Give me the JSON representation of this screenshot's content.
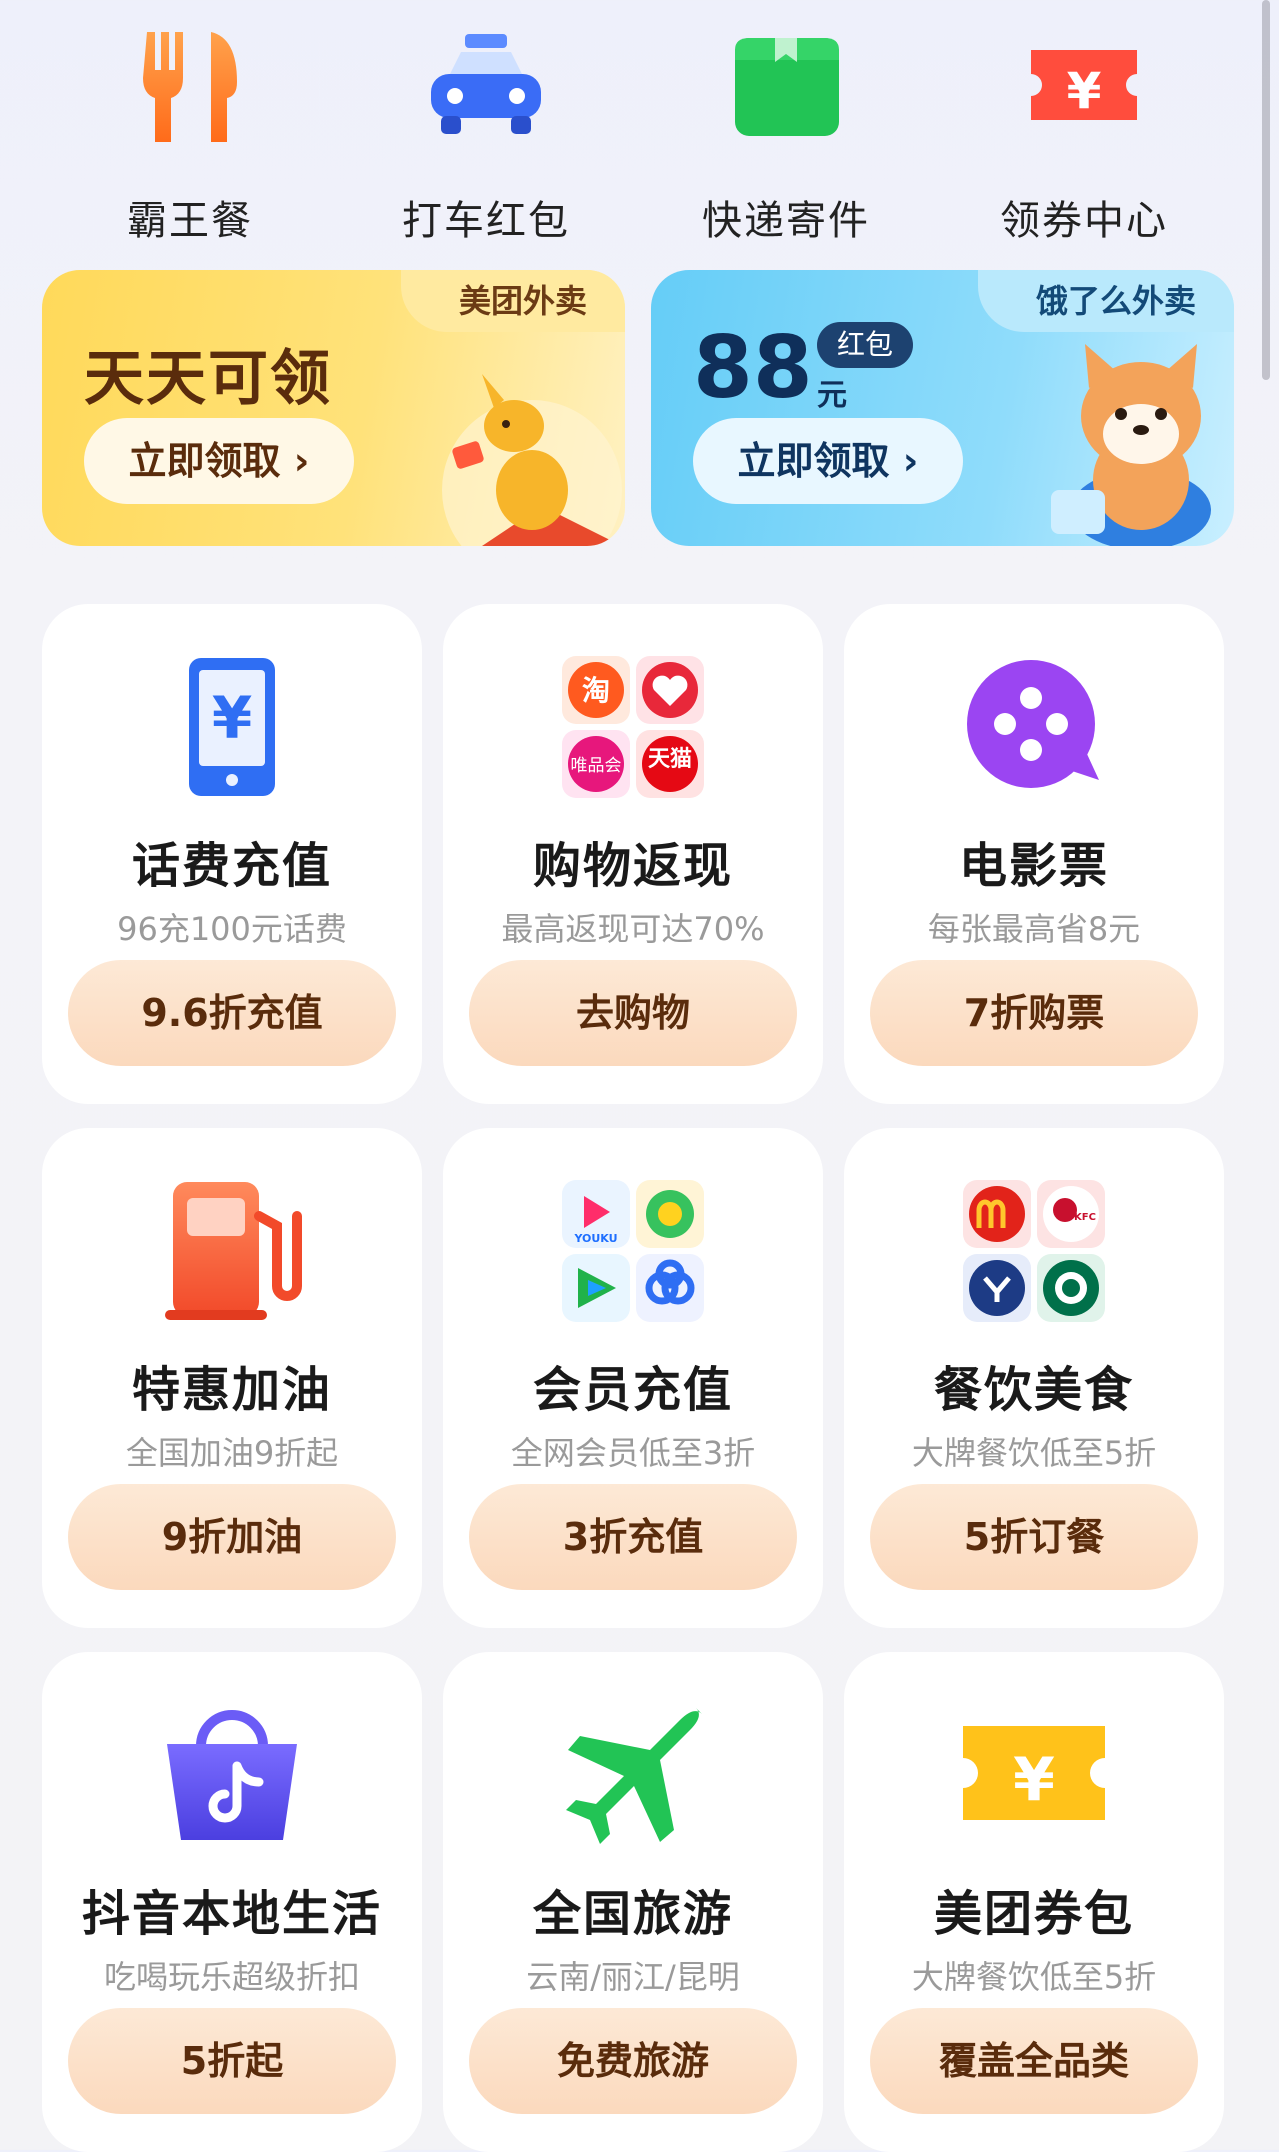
{
  "top_items": [
    {
      "label": "霸王餐",
      "icon": "fork-knife-icon"
    },
    {
      "label": "打车红包",
      "icon": "taxi-icon"
    },
    {
      "label": "快递寄件",
      "icon": "package-icon"
    },
    {
      "label": "领券中心",
      "icon": "yuan-coupon-icon"
    }
  ],
  "banners": {
    "meituan": {
      "tag": "美团外卖",
      "title": "天天可领",
      "button": "立即领取 ›"
    },
    "eleme": {
      "tag": "饿了么外卖",
      "amount": "88",
      "badge": "红包",
      "unit": "元",
      "button": "立即领取 ›"
    }
  },
  "cards": [
    {
      "title": "话费充值",
      "sub": "96充100元话费",
      "button": "9.6折充值",
      "icon": "phone-yuan-icon"
    },
    {
      "title": "购物返现",
      "sub": "最高返现可达70%",
      "button": "去购物",
      "icon": "shopping-apps-icon",
      "app_labels": [
        "淘",
        "唯品会",
        "天猫"
      ]
    },
    {
      "title": "电影票",
      "sub": "每张最高省8元",
      "button": "7折购票",
      "icon": "film-reel-icon"
    },
    {
      "title": "特惠加油",
      "sub": "全国加油9折起",
      "button": "9折加油",
      "icon": "gas-pump-icon"
    },
    {
      "title": "会员充值",
      "sub": "全网会员低至3折",
      "button": "3折充值",
      "icon": "video-apps-icon",
      "app_labels": [
        "YOUKU"
      ]
    },
    {
      "title": "餐饮美食",
      "sub": "大牌餐饮低至5折",
      "button": "5折订餐",
      "icon": "restaurant-brands-icon",
      "app_labels": [
        "KFC"
      ]
    },
    {
      "title": "抖音本地生活",
      "sub": "吃喝玩乐超级折扣",
      "button": "5折起",
      "icon": "douyin-basket-icon"
    },
    {
      "title": "全国旅游",
      "sub": "云南/丽江/昆明",
      "button": "免费旅游",
      "icon": "airplane-icon"
    },
    {
      "title": "美团券包",
      "sub": "大牌餐饮低至5折",
      "button": "覆盖全品类",
      "icon": "yuan-ticket-icon"
    }
  ],
  "colors": {
    "accent_button": "#fbd9bd",
    "button_text": "#5a2c0c",
    "card_bg": "#ffffff"
  }
}
